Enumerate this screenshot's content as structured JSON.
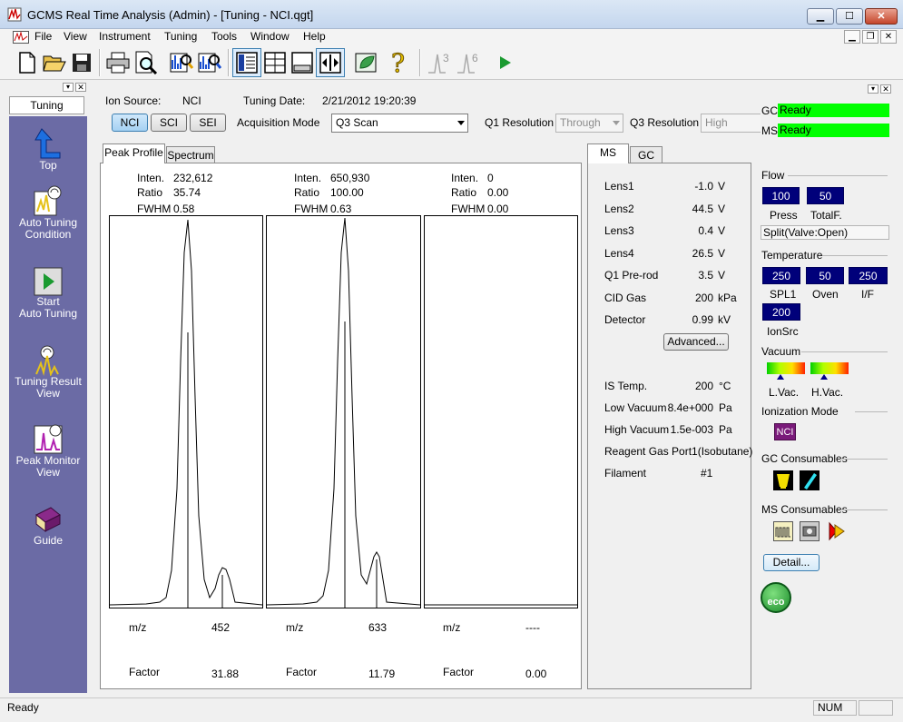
{
  "window": {
    "title": "GCMS Real Time Analysis (Admin) - [Tuning - NCI.qgt]",
    "min": "▁",
    "max": "☐",
    "close": "✕"
  },
  "menu": [
    "File",
    "View",
    "Instrument",
    "Tuning",
    "Tools",
    "Window",
    "Help"
  ],
  "toolbar": {
    "peak3": "3",
    "peak6": "6"
  },
  "left_panel": {
    "tab": "Tuning",
    "items": [
      {
        "label": "Top"
      },
      {
        "label1": "Auto Tuning",
        "label2": "Condition"
      },
      {
        "label1": "Start",
        "label2": "Auto Tuning"
      },
      {
        "label1": "Tuning Result",
        "label2": "View"
      },
      {
        "label1": "Peak Monitor",
        "label2": "View"
      },
      {
        "label": "Guide"
      }
    ]
  },
  "header": {
    "ion_source_label": "Ion Source:",
    "ion_source_value": "NCI",
    "tuning_date_label": "Tuning Date:",
    "tuning_date_value": "2/21/2012 19:20:39",
    "ion_buttons": [
      "NCI",
      "SCI",
      "SEI"
    ],
    "ion_selected": "NCI",
    "acq_mode_label": "Acquisition Mode",
    "acq_mode_value": "Q3 Scan",
    "q1_res_label": "Q1 Resolution",
    "q1_res_value": "Through",
    "q3_res_label": "Q3 Resolution",
    "q3_res_value": "High"
  },
  "tabs": {
    "peak_profile": "Peak Profile",
    "spectrum": "Spectrum"
  },
  "peaks": [
    {
      "inten_label": "Inten.",
      "inten": "232,612",
      "ratio_label": "Ratio",
      "ratio": "35.74",
      "fwhm_label": "FWHM",
      "fwhm": "0.58",
      "mz_label": "m/z",
      "mz": "452",
      "factor_label": "Factor",
      "factor": "31.88"
    },
    {
      "inten_label": "Inten.",
      "inten": "650,930",
      "ratio_label": "Ratio",
      "ratio": "100.00",
      "fwhm_label": "FWHM",
      "fwhm": "0.63",
      "mz_label": "m/z",
      "mz": "633",
      "factor_label": "Factor",
      "factor": "11.79"
    },
    {
      "inten_label": "Inten.",
      "inten": "0",
      "ratio_label": "Ratio",
      "ratio": "0.00",
      "fwhm_label": "FWHM",
      "fwhm": "0.00",
      "mz_label": "m/z",
      "mz": "----",
      "factor_label": "Factor",
      "factor": "0.00"
    }
  ],
  "ms_tabs": {
    "ms": "MS",
    "gc": "GC"
  },
  "ms_params": [
    {
      "name": "Lens1",
      "value": "-1.0",
      "unit": "V"
    },
    {
      "name": "Lens2",
      "value": "44.5",
      "unit": "V"
    },
    {
      "name": "Lens3",
      "value": "0.4",
      "unit": "V"
    },
    {
      "name": "Lens4",
      "value": "26.5",
      "unit": "V"
    },
    {
      "name": "Q1 Pre-rod",
      "value": "3.5",
      "unit": "V"
    },
    {
      "name": "CID Gas",
      "value": "200",
      "unit": "kPa"
    },
    {
      "name": "Detector",
      "value": "0.99",
      "unit": "kV"
    }
  ],
  "advanced_button": "Advanced...",
  "ms_status": [
    {
      "name": "IS Temp.",
      "value": "200",
      "unit": "°C"
    },
    {
      "name": "Low Vacuum",
      "value": "8.4e+000",
      "unit": "Pa"
    },
    {
      "name": "High Vacuum",
      "value": "1.5e-003",
      "unit": "Pa"
    }
  ],
  "reagent_gas": "Reagent Gas Port1(Isobutane)",
  "filament_label": "Filament",
  "filament_value": "#1",
  "right_panel": {
    "gc_label": "GC",
    "gc_status": "Ready",
    "ms_label": "MS",
    "ms_status": "Ready",
    "flow_title": "Flow",
    "flow": [
      {
        "value": "100",
        "label": "Press"
      },
      {
        "value": "50",
        "label": "TotalF."
      }
    ],
    "split": "Split(Valve:Open)",
    "temp_title": "Temperature",
    "temps": [
      {
        "value": "250",
        "label": "SPL1"
      },
      {
        "value": "50",
        "label": "Oven"
      },
      {
        "value": "250",
        "label": "I/F"
      },
      {
        "value": "200",
        "label": "IonSrc"
      }
    ],
    "vacuum_title": "Vacuum",
    "vac_labels": [
      "L.Vac.",
      "H.Vac."
    ],
    "ion_mode_title": "Ionization Mode",
    "ion_mode_value": "NCI",
    "gc_cons_title": "GC Consumables",
    "ms_cons_title": "MS Consumables",
    "detail_button": "Detail...",
    "eco": "eco"
  },
  "status": {
    "left": "Ready",
    "num": "NUM"
  },
  "colors": {
    "nav_bg": "#6b6ba5",
    "navy": "#00007a",
    "ready_green": "#00ff00",
    "ion_mode_purple": "#7a1a7a"
  }
}
